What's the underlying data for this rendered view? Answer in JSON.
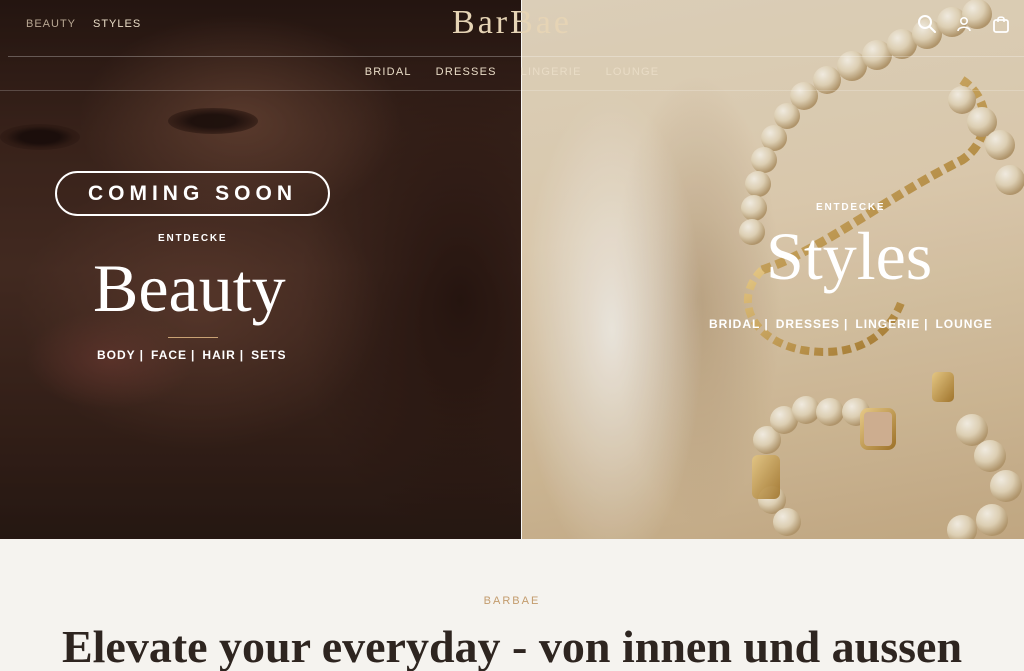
{
  "header": {
    "top_links": [
      "BEAUTY",
      "STYLES"
    ],
    "logo": "BarBae",
    "icons": [
      "search-icon",
      "account-icon",
      "bag-icon"
    ],
    "nav": [
      "BRIDAL",
      "DRESSES",
      "LINGERIE",
      "LOUNGE"
    ]
  },
  "left_hero": {
    "badge": "COMING SOON",
    "eyebrow": "ENTDECKE",
    "title": "Beauty",
    "links": [
      "BODY",
      "FACE",
      "HAIR",
      "SETS"
    ]
  },
  "right_hero": {
    "eyebrow": "ENTDECKE",
    "title": "Styles",
    "links": [
      "BRIDAL",
      "DRESSES",
      "LINGERIE",
      "LOUNGE"
    ]
  },
  "intro": {
    "brand": "BARBAE",
    "headline": "Elevate your everyday - von innen und aussen"
  },
  "colors": {
    "accent_gold": "#c9a274",
    "logo": "#e6d4b5",
    "background": "#f5f3ef",
    "headline": "#2e2520"
  }
}
